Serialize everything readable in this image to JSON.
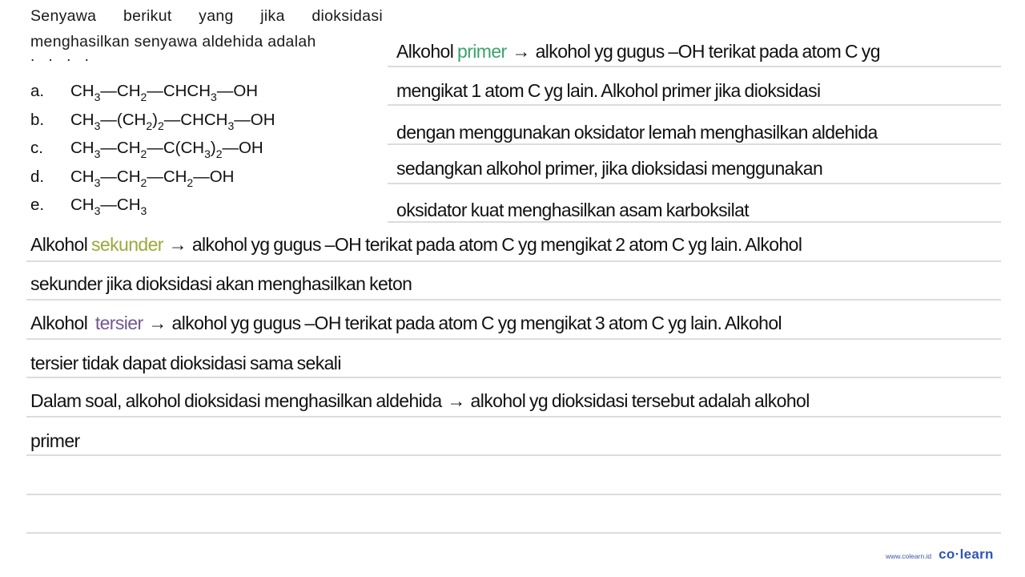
{
  "question": {
    "lines": [
      "Senyawa berikut yang jika dioksidasi",
      "menghasilkan senyawa aldehida adalah"
    ],
    "dots": ". . . .",
    "options": [
      {
        "letter": "a.",
        "formula": [
          [
            "CH",
            "3"
          ],
          [
            "—CH",
            "2"
          ],
          [
            "—CHCH",
            "3"
          ],
          [
            "—OH",
            ""
          ]
        ]
      },
      {
        "letter": "b.",
        "formula": [
          [
            "CH",
            "3"
          ],
          [
            "—(CH",
            "2"
          ],
          [
            ")",
            "2"
          ],
          [
            "—CHCH",
            "3"
          ],
          [
            "—OH",
            ""
          ]
        ]
      },
      {
        "letter": "c.",
        "formula": [
          [
            "CH",
            "3"
          ],
          [
            "—CH",
            "2"
          ],
          [
            "—C(CH",
            "3"
          ],
          [
            ")",
            "2"
          ],
          [
            "—OH",
            ""
          ]
        ]
      },
      {
        "letter": "d.",
        "formula": [
          [
            "CH",
            "3"
          ],
          [
            "—CH",
            "2"
          ],
          [
            "—CH",
            "2"
          ],
          [
            "—OH",
            ""
          ]
        ]
      },
      {
        "letter": "e.",
        "formula": [
          [
            "CH",
            "3"
          ],
          [
            "—CH",
            "3"
          ]
        ]
      }
    ]
  },
  "explanation": {
    "arrow": "→",
    "primer_line1": {
      "pre": "Alkohol ",
      "term": "primer",
      "post": " alkohol yg gugus –OH terikat pada atom C yg"
    },
    "primer_line2": "mengikat 1 atom C yg lain. Alkohol primer jika dioksidasi",
    "primer_line3": "dengan menggunakan oksidator lemah  menghasilkan aldehida",
    "primer_line4": "sedangkan alkohol primer, jika dioksidasi menggunakan",
    "primer_line5": "oksidator kuat  menghasilkan asam karboksilat",
    "sekunder_line1": {
      "pre": "Alkohol ",
      "term": "sekunder",
      "post": " alkohol yg gugus –OH terikat pada atom C yg mengikat 2 atom C yg lain. Alkohol"
    },
    "sekunder_line2": "sekunder jika dioksidasi akan menghasilkan keton",
    "tersier_line1": {
      "pre": "Alkohol  ",
      "term": "tersier",
      "post": " alkohol yg gugus –OH terikat pada atom C yg mengikat 3 atom C yg lain. Alkohol"
    },
    "tersier_line2": "tersier tidak dapat dioksidasi sama sekali",
    "conclusion_line1": {
      "pre": "Dalam soal, alkohol dioksidasi menghasilkan aldehida ",
      "post": " alkohol yg dioksidasi tersebut adalah alkohol"
    },
    "conclusion_line2": "primer"
  },
  "colors": {
    "primer": "#3aa36a",
    "sekunder": "#9aaa3a",
    "tersier": "#74568f",
    "rule": "#dcdcdf",
    "brand": "#2f55b5"
  },
  "brand": {
    "url": "www.colearn.id",
    "logo": "co·learn"
  }
}
